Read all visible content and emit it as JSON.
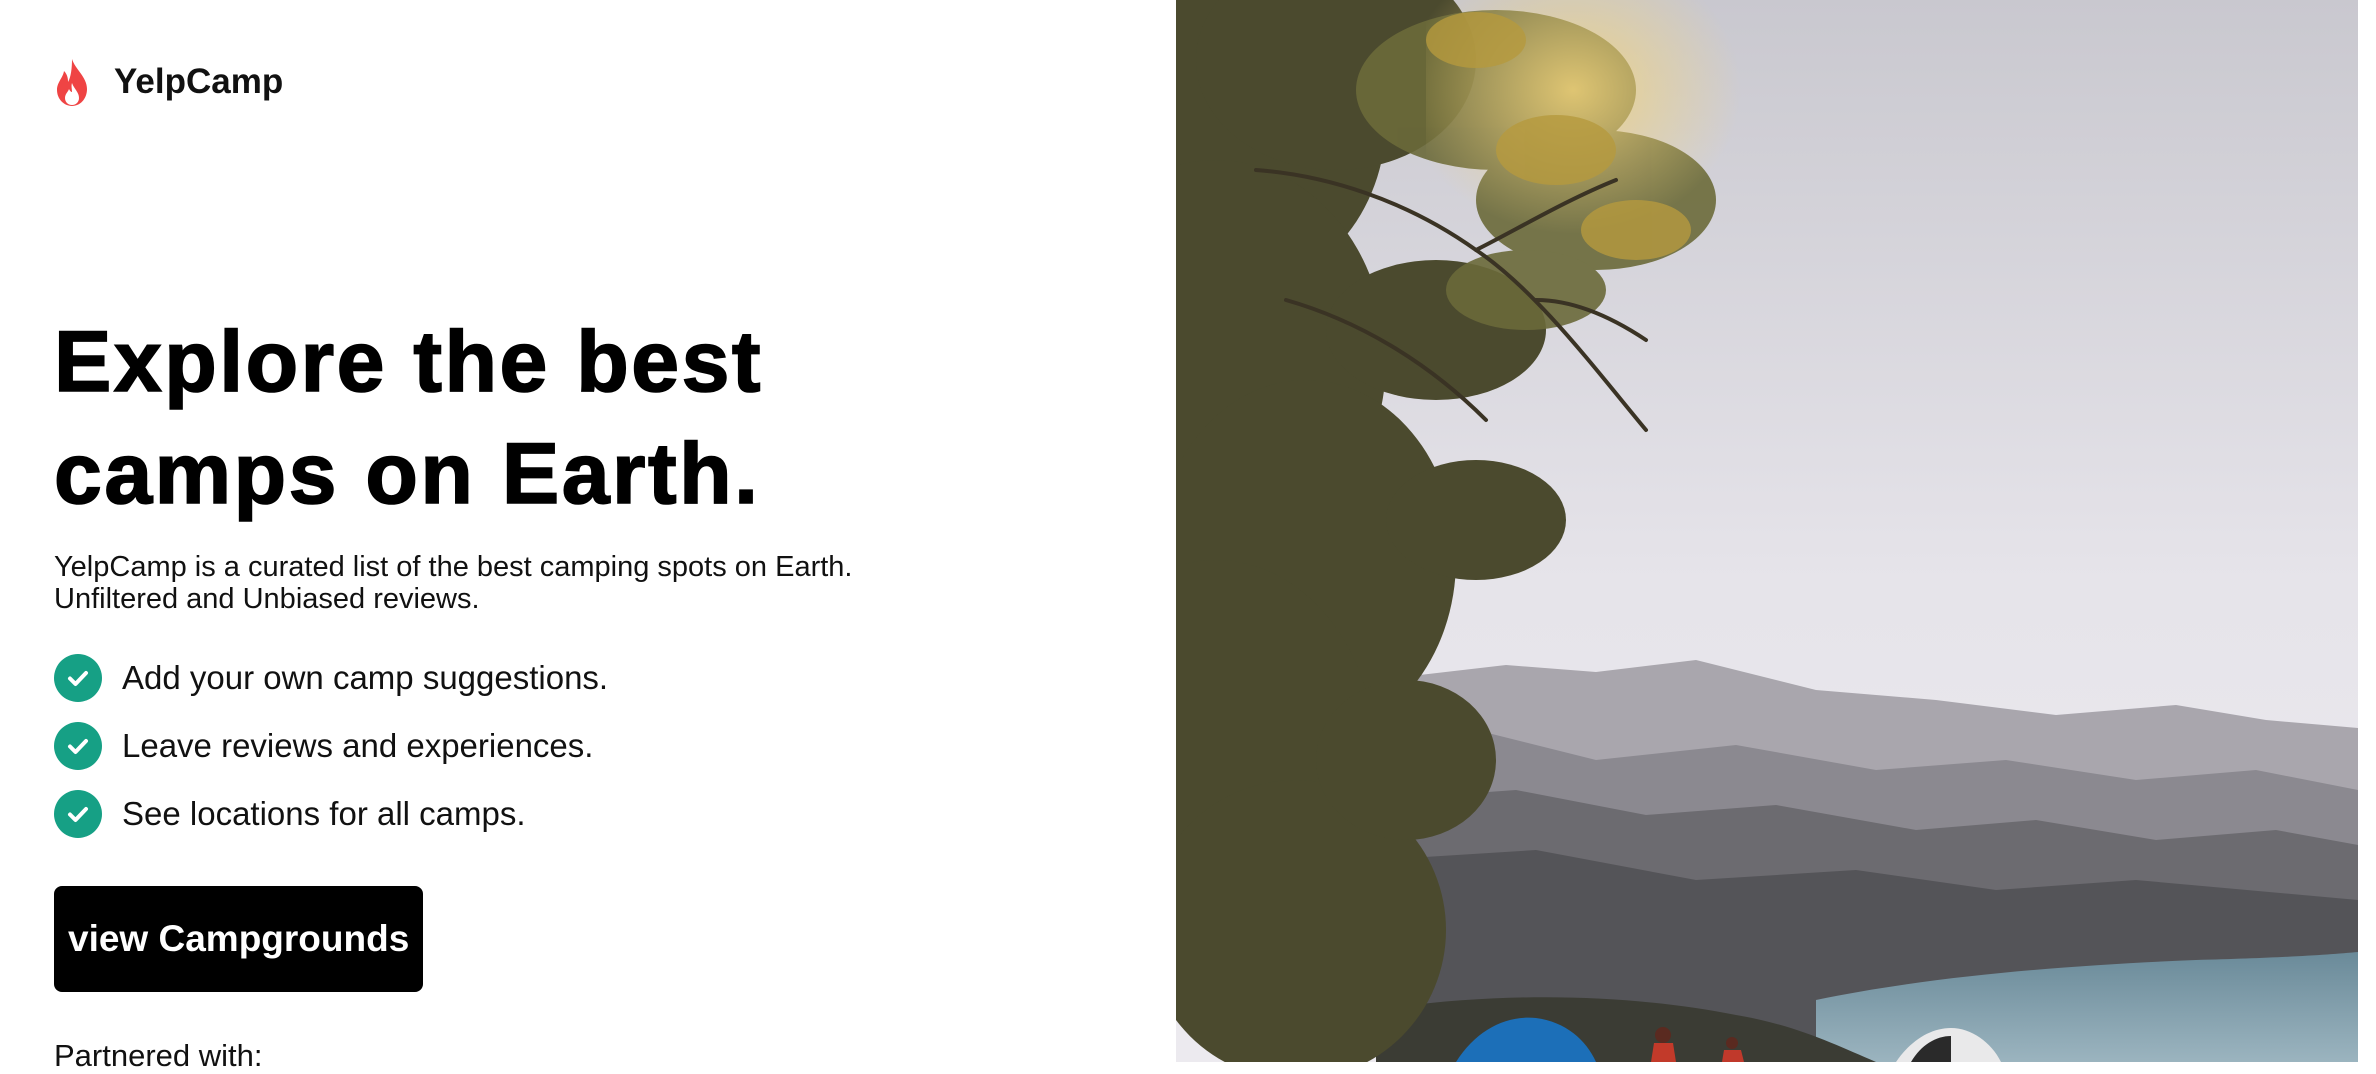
{
  "brand": {
    "name": "YelpCamp",
    "icon": "flame-icon",
    "icon_color": "#ef4444"
  },
  "hero": {
    "headline_line1": "Explore the best",
    "headline_line2": "camps on Earth.",
    "description_line1": "YelpCamp is a curated list of the best camping spots on Earth.",
    "description_line2": "Unfiltered and Unbiased reviews."
  },
  "features": [
    {
      "label": "Add your own camp suggestions.",
      "icon": "check-circle-icon"
    },
    {
      "label": "Leave reviews and experiences.",
      "icon": "check-circle-icon"
    },
    {
      "label": "See locations for all camps.",
      "icon": "check-circle-icon"
    }
  ],
  "cta": {
    "label": "view Campgrounds"
  },
  "partners": {
    "label": "Partnered with:"
  },
  "colors": {
    "accent": "#16a085",
    "button_bg": "#000000",
    "flame": "#ef4444"
  }
}
